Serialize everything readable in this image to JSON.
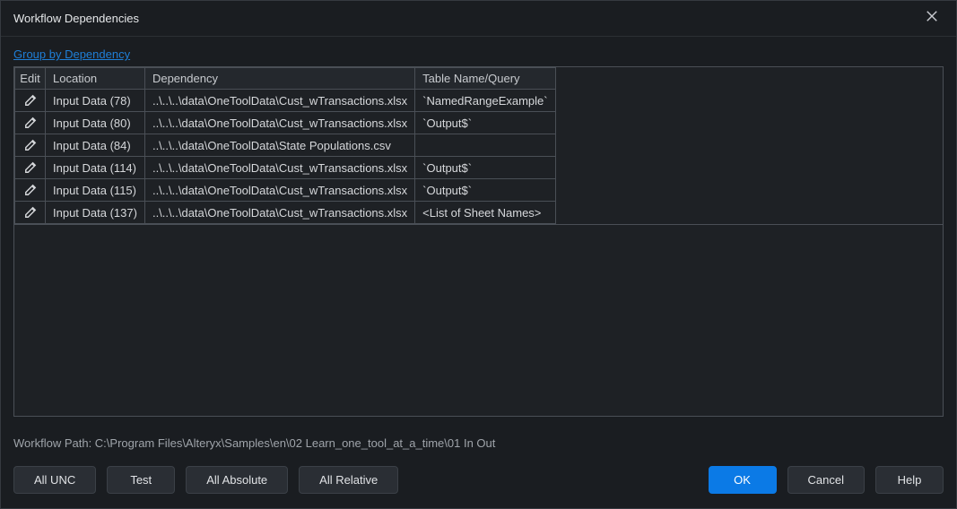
{
  "titlebar": {
    "title": "Workflow Dependencies"
  },
  "group_link": "Group by Dependency",
  "headers": {
    "edit": "Edit",
    "location": "Location",
    "dependency": "Dependency",
    "table_name": "Table Name/Query"
  },
  "rows": [
    {
      "location": "Input Data (78)",
      "dependency": "..\\..\\..\\data\\OneToolData\\Cust_wTransactions.xlsx",
      "table_name": "`NamedRangeExample`"
    },
    {
      "location": "Input Data (80)",
      "dependency": "..\\..\\..\\data\\OneToolData\\Cust_wTransactions.xlsx",
      "table_name": "`Output$`"
    },
    {
      "location": "Input Data (84)",
      "dependency": "..\\..\\..\\data\\OneToolData\\State Populations.csv",
      "table_name": ""
    },
    {
      "location": "Input Data (114)",
      "dependency": "..\\..\\..\\data\\OneToolData\\Cust_wTransactions.xlsx",
      "table_name": "`Output$`"
    },
    {
      "location": "Input Data (115)",
      "dependency": "..\\..\\..\\data\\OneToolData\\Cust_wTransactions.xlsx",
      "table_name": "`Output$`"
    },
    {
      "location": "Input Data (137)",
      "dependency": "..\\..\\..\\data\\OneToolData\\Cust_wTransactions.xlsx",
      "table_name": "<List of Sheet Names>"
    }
  ],
  "workflow_path_label": "Workflow Path: ",
  "workflow_path": "C:\\Program Files\\Alteryx\\Samples\\en\\02 Learn_one_tool_at_a_time\\01 In Out",
  "buttons": {
    "all_unc": "All UNC",
    "test": "Test",
    "all_absolute": "All Absolute",
    "all_relative": "All Relative",
    "ok": "OK",
    "cancel": "Cancel",
    "help": "Help"
  }
}
